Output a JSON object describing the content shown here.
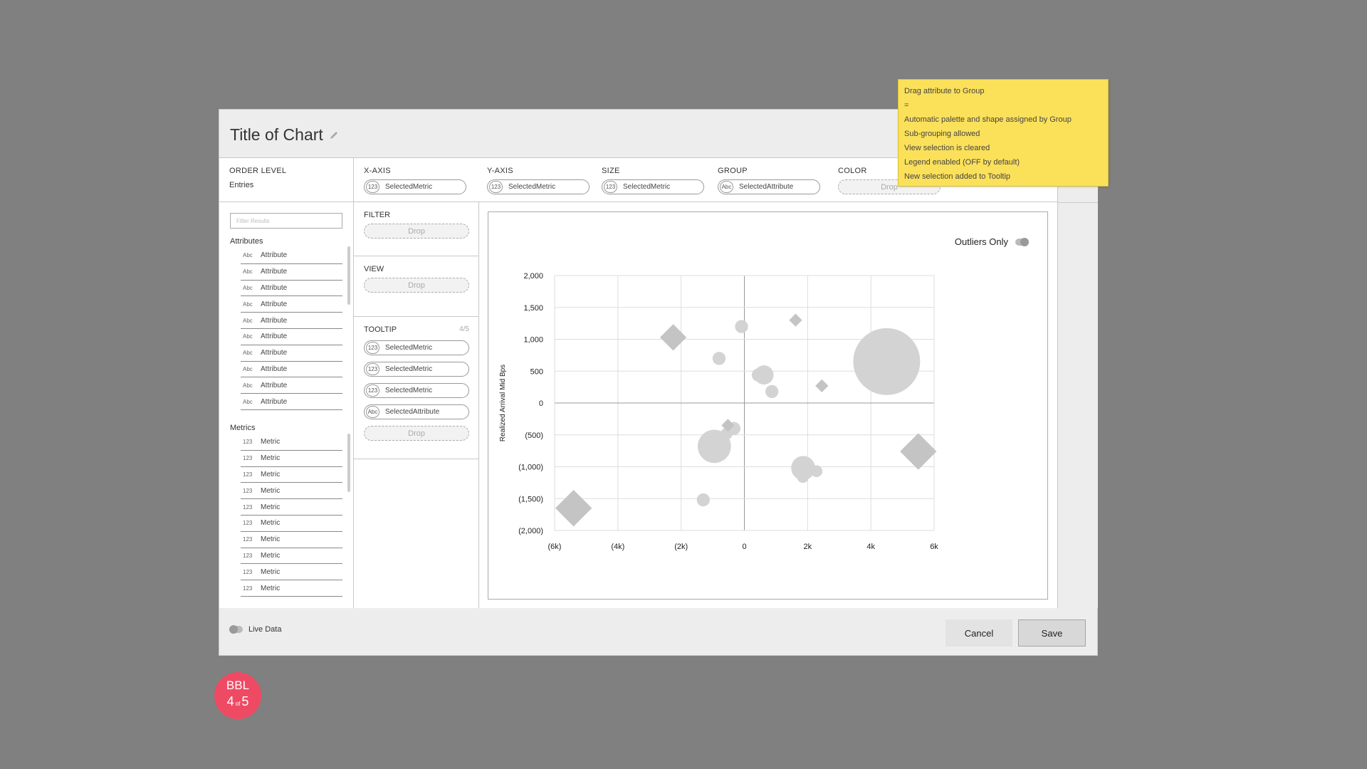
{
  "title": "Title of Chart",
  "order_level": {
    "label": "ORDER LEVEL",
    "value": "Entries"
  },
  "shelves": {
    "x_axis": {
      "label": "X-AXIS",
      "tag": "123",
      "value": "SelectedMetric"
    },
    "y_axis": {
      "label": "Y-AXIS",
      "tag": "123",
      "value": "SelectedMetric"
    },
    "size": {
      "label": "SIZE",
      "tag": "123",
      "value": "SelectedMetric"
    },
    "group": {
      "label": "GROUP",
      "tag": "Abc",
      "value": "SelectedAttribute"
    },
    "color": {
      "label": "COLOR",
      "drop": "Drop"
    }
  },
  "left_panel": {
    "filter_placeholder": "Filter Results",
    "attributes_title": "Attributes",
    "attributes": [
      {
        "tag": "Abc",
        "label": "Attribute"
      },
      {
        "tag": "Abc",
        "label": "Attribute"
      },
      {
        "tag": "Abc",
        "label": "Attribute"
      },
      {
        "tag": "Abc",
        "label": "Attribute"
      },
      {
        "tag": "Abc",
        "label": "Attribute"
      },
      {
        "tag": "Abc",
        "label": "Attribute"
      },
      {
        "tag": "Abc",
        "label": "Attribute"
      },
      {
        "tag": "Abc",
        "label": "Attribute"
      },
      {
        "tag": "Abc",
        "label": "Attribute"
      },
      {
        "tag": "Abc",
        "label": "Attribute"
      }
    ],
    "metrics_title": "Metrics",
    "metrics": [
      {
        "tag": "123",
        "label": "Metric"
      },
      {
        "tag": "123",
        "label": "Metric"
      },
      {
        "tag": "123",
        "label": "Metric"
      },
      {
        "tag": "123",
        "label": "Metric"
      },
      {
        "tag": "123",
        "label": "Metric"
      },
      {
        "tag": "123",
        "label": "Metric"
      },
      {
        "tag": "123",
        "label": "Metric"
      },
      {
        "tag": "123",
        "label": "Metric"
      },
      {
        "tag": "123",
        "label": "Metric"
      },
      {
        "tag": "123",
        "label": "Metric"
      }
    ]
  },
  "mid_panel": {
    "filter": {
      "label": "FILTER",
      "drop": "Drop"
    },
    "view": {
      "label": "VIEW",
      "drop": "Drop"
    },
    "tooltip": {
      "label": "TOOLTIP",
      "count": "4/5",
      "items": [
        {
          "tag": "123",
          "value": "SelectedMetric"
        },
        {
          "tag": "123",
          "value": "SelectedMetric"
        },
        {
          "tag": "123",
          "value": "SelectedMetric"
        },
        {
          "tag": "Abc",
          "value": "SelectedAttribute"
        }
      ],
      "drop": "Drop"
    }
  },
  "chart_toggle": {
    "label": "Outliers Only",
    "on": true
  },
  "chart_data": {
    "type": "scatter",
    "title": "",
    "xlabel": "",
    "ylabel": "Realized Arrival Mid Bps",
    "xlim": [
      -6000,
      6000
    ],
    "ylim": [
      -2000,
      2000
    ],
    "x_ticks": [
      "(6k)",
      "(4k)",
      "(2k)",
      "0",
      "2k",
      "4k",
      "6k"
    ],
    "y_ticks": [
      "2,000",
      "1,500",
      "1,000",
      "500",
      "0",
      "(500)",
      "(1,000)",
      "(1,500)",
      "(2,000)"
    ],
    "grid": true,
    "legend": "none",
    "color": "#d3d3d3",
    "points": [
      {
        "x": -5400,
        "y": -1650,
        "shape": "diamond",
        "size": 0.45
      },
      {
        "x": -2250,
        "y": 1030,
        "shape": "diamond",
        "size": 0.3
      },
      {
        "x": -950,
        "y": -680,
        "shape": "circle",
        "size": 0.45
      },
      {
        "x": -1300,
        "y": -1520,
        "shape": "circle",
        "size": 0.12
      },
      {
        "x": -800,
        "y": 700,
        "shape": "circle",
        "size": 0.12
      },
      {
        "x": -90,
        "y": 1200,
        "shape": "circle",
        "size": 0.12
      },
      {
        "x": 440,
        "y": 440,
        "shape": "circle",
        "size": 0.12
      },
      {
        "x": 620,
        "y": 440,
        "shape": "circle",
        "size": 0.22
      },
      {
        "x": 870,
        "y": 180,
        "shape": "circle",
        "size": 0.12
      },
      {
        "x": -560,
        "y": -480,
        "shape": "circle",
        "size": 0.1
      },
      {
        "x": -330,
        "y": -400,
        "shape": "circle",
        "size": 0.12
      },
      {
        "x": -520,
        "y": -350,
        "shape": "diamond",
        "size": 0.1
      },
      {
        "x": 1620,
        "y": 1300,
        "shape": "diamond",
        "size": 0.1
      },
      {
        "x": 2450,
        "y": 270,
        "shape": "diamond",
        "size": 0.1
      },
      {
        "x": 1860,
        "y": -1020,
        "shape": "circle",
        "size": 0.3
      },
      {
        "x": 1850,
        "y": -1160,
        "shape": "circle",
        "size": 0.1
      },
      {
        "x": 2280,
        "y": -1070,
        "shape": "circle",
        "size": 0.1
      },
      {
        "x": 4500,
        "y": 650,
        "shape": "circle",
        "size": 1.0
      },
      {
        "x": 5500,
        "y": -760,
        "shape": "diamond",
        "size": 0.45
      }
    ]
  },
  "footer": {
    "live_data": "Live Data",
    "cancel": "Cancel",
    "save": "Save"
  },
  "sticky_note": [
    "Drag attribute to Group",
    "=",
    "Automatic palette and shape assigned by Group",
    "Sub-grouping allowed",
    "View selection is cleared",
    "Legend enabled (OFF by default)",
    "New selection added to Tooltip"
  ],
  "badge": {
    "line1": "BBL",
    "current": "4",
    "of": "of",
    "total": "5"
  }
}
